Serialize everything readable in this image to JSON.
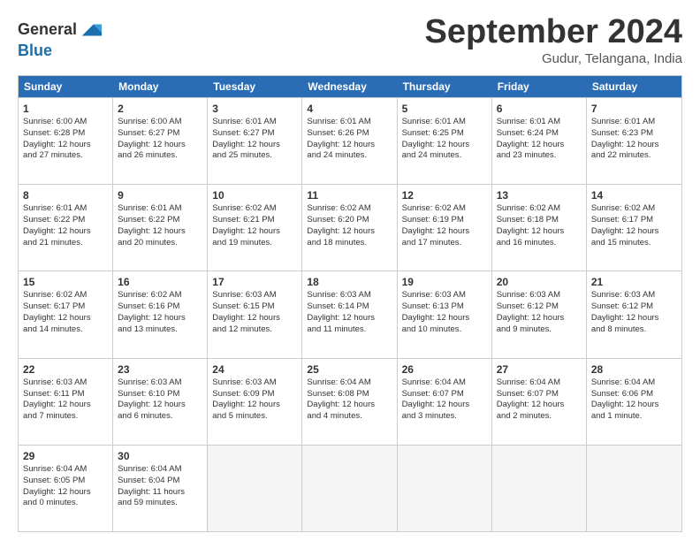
{
  "header": {
    "logo_line1": "General",
    "logo_line2": "Blue",
    "month": "September 2024",
    "location": "Gudur, Telangana, India"
  },
  "days_of_week": [
    "Sunday",
    "Monday",
    "Tuesday",
    "Wednesday",
    "Thursday",
    "Friday",
    "Saturday"
  ],
  "weeks": [
    [
      {
        "day": "1",
        "info": "Sunrise: 6:00 AM\nSunset: 6:28 PM\nDaylight: 12 hours\nand 27 minutes."
      },
      {
        "day": "2",
        "info": "Sunrise: 6:00 AM\nSunset: 6:27 PM\nDaylight: 12 hours\nand 26 minutes."
      },
      {
        "day": "3",
        "info": "Sunrise: 6:01 AM\nSunset: 6:27 PM\nDaylight: 12 hours\nand 25 minutes."
      },
      {
        "day": "4",
        "info": "Sunrise: 6:01 AM\nSunset: 6:26 PM\nDaylight: 12 hours\nand 24 minutes."
      },
      {
        "day": "5",
        "info": "Sunrise: 6:01 AM\nSunset: 6:25 PM\nDaylight: 12 hours\nand 24 minutes."
      },
      {
        "day": "6",
        "info": "Sunrise: 6:01 AM\nSunset: 6:24 PM\nDaylight: 12 hours\nand 23 minutes."
      },
      {
        "day": "7",
        "info": "Sunrise: 6:01 AM\nSunset: 6:23 PM\nDaylight: 12 hours\nand 22 minutes."
      }
    ],
    [
      {
        "day": "8",
        "info": "Sunrise: 6:01 AM\nSunset: 6:22 PM\nDaylight: 12 hours\nand 21 minutes."
      },
      {
        "day": "9",
        "info": "Sunrise: 6:01 AM\nSunset: 6:22 PM\nDaylight: 12 hours\nand 20 minutes."
      },
      {
        "day": "10",
        "info": "Sunrise: 6:02 AM\nSunset: 6:21 PM\nDaylight: 12 hours\nand 19 minutes."
      },
      {
        "day": "11",
        "info": "Sunrise: 6:02 AM\nSunset: 6:20 PM\nDaylight: 12 hours\nand 18 minutes."
      },
      {
        "day": "12",
        "info": "Sunrise: 6:02 AM\nSunset: 6:19 PM\nDaylight: 12 hours\nand 17 minutes."
      },
      {
        "day": "13",
        "info": "Sunrise: 6:02 AM\nSunset: 6:18 PM\nDaylight: 12 hours\nand 16 minutes."
      },
      {
        "day": "14",
        "info": "Sunrise: 6:02 AM\nSunset: 6:17 PM\nDaylight: 12 hours\nand 15 minutes."
      }
    ],
    [
      {
        "day": "15",
        "info": "Sunrise: 6:02 AM\nSunset: 6:17 PM\nDaylight: 12 hours\nand 14 minutes."
      },
      {
        "day": "16",
        "info": "Sunrise: 6:02 AM\nSunset: 6:16 PM\nDaylight: 12 hours\nand 13 minutes."
      },
      {
        "day": "17",
        "info": "Sunrise: 6:03 AM\nSunset: 6:15 PM\nDaylight: 12 hours\nand 12 minutes."
      },
      {
        "day": "18",
        "info": "Sunrise: 6:03 AM\nSunset: 6:14 PM\nDaylight: 12 hours\nand 11 minutes."
      },
      {
        "day": "19",
        "info": "Sunrise: 6:03 AM\nSunset: 6:13 PM\nDaylight: 12 hours\nand 10 minutes."
      },
      {
        "day": "20",
        "info": "Sunrise: 6:03 AM\nSunset: 6:12 PM\nDaylight: 12 hours\nand 9 minutes."
      },
      {
        "day": "21",
        "info": "Sunrise: 6:03 AM\nSunset: 6:12 PM\nDaylight: 12 hours\nand 8 minutes."
      }
    ],
    [
      {
        "day": "22",
        "info": "Sunrise: 6:03 AM\nSunset: 6:11 PM\nDaylight: 12 hours\nand 7 minutes."
      },
      {
        "day": "23",
        "info": "Sunrise: 6:03 AM\nSunset: 6:10 PM\nDaylight: 12 hours\nand 6 minutes."
      },
      {
        "day": "24",
        "info": "Sunrise: 6:03 AM\nSunset: 6:09 PM\nDaylight: 12 hours\nand 5 minutes."
      },
      {
        "day": "25",
        "info": "Sunrise: 6:04 AM\nSunset: 6:08 PM\nDaylight: 12 hours\nand 4 minutes."
      },
      {
        "day": "26",
        "info": "Sunrise: 6:04 AM\nSunset: 6:07 PM\nDaylight: 12 hours\nand 3 minutes."
      },
      {
        "day": "27",
        "info": "Sunrise: 6:04 AM\nSunset: 6:07 PM\nDaylight: 12 hours\nand 2 minutes."
      },
      {
        "day": "28",
        "info": "Sunrise: 6:04 AM\nSunset: 6:06 PM\nDaylight: 12 hours\nand 1 minute."
      }
    ],
    [
      {
        "day": "29",
        "info": "Sunrise: 6:04 AM\nSunset: 6:05 PM\nDaylight: 12 hours\nand 0 minutes."
      },
      {
        "day": "30",
        "info": "Sunrise: 6:04 AM\nSunset: 6:04 PM\nDaylight: 11 hours\nand 59 minutes."
      },
      {
        "day": "",
        "info": ""
      },
      {
        "day": "",
        "info": ""
      },
      {
        "day": "",
        "info": ""
      },
      {
        "day": "",
        "info": ""
      },
      {
        "day": "",
        "info": ""
      }
    ]
  ]
}
